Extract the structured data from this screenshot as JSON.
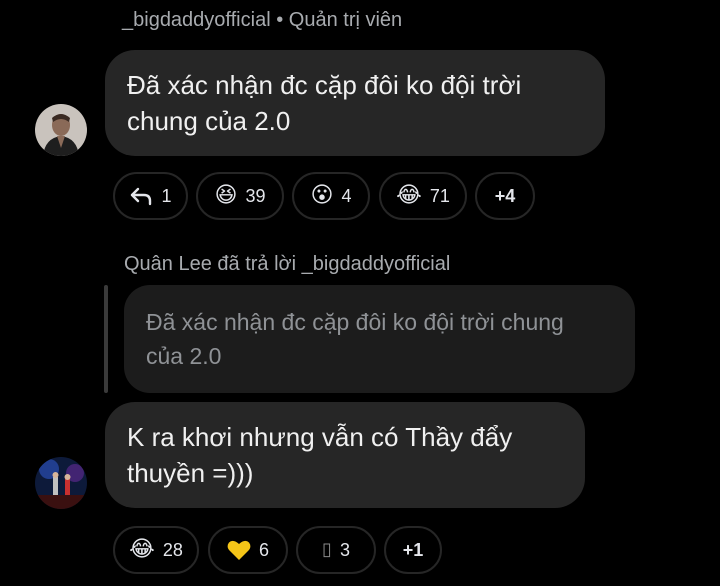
{
  "message1": {
    "sender": "_bigdaddyofficial",
    "separator": "•",
    "role": "Quản trị viên",
    "avatar_icon": "user-avatar",
    "text_line1": "Đã xác nhận đc cặp đôi ko đội trời",
    "text_line2": "chung của 2.0",
    "reactions": [
      {
        "icon": "reply-icon",
        "glyph": "↰",
        "count": "1"
      },
      {
        "icon": "laughing-face-icon",
        "glyph": "😆",
        "count": "39"
      },
      {
        "icon": "surprised-face-icon",
        "glyph": "😮",
        "count": "4"
      },
      {
        "icon": "tears-of-joy-icon",
        "glyph": "😂",
        "count": "71"
      },
      {
        "icon": "",
        "glyph": "",
        "count": "+4"
      }
    ]
  },
  "reply": {
    "header": "Quân Lee đã trả lời _bigdaddyofficial",
    "quoted_line1": "Đã xác nhận đc cặp đôi ko đội trời chung",
    "quoted_line2": "của 2.0"
  },
  "message2": {
    "avatar_icon": "concert-avatar",
    "text_line1": "K ra khơi nhưng vẫn có Thầy đẩy",
    "text_line2": "thuyền =)))",
    "reactions": [
      {
        "icon": "tears-of-joy-icon",
        "glyph": "😂",
        "count": "28"
      },
      {
        "icon": "yellow-heart-icon",
        "glyph": "💛",
        "count": "6"
      },
      {
        "icon": "missing-glyph-icon",
        "glyph": "▯",
        "count": "3"
      },
      {
        "icon": "",
        "glyph": "",
        "count": "+1"
      }
    ]
  },
  "colors": {
    "background": "#000000",
    "bubble": "#262626",
    "quote_bubble": "#1c1c1c",
    "muted_text": "#a8abaf",
    "heart": "#f5c518"
  }
}
